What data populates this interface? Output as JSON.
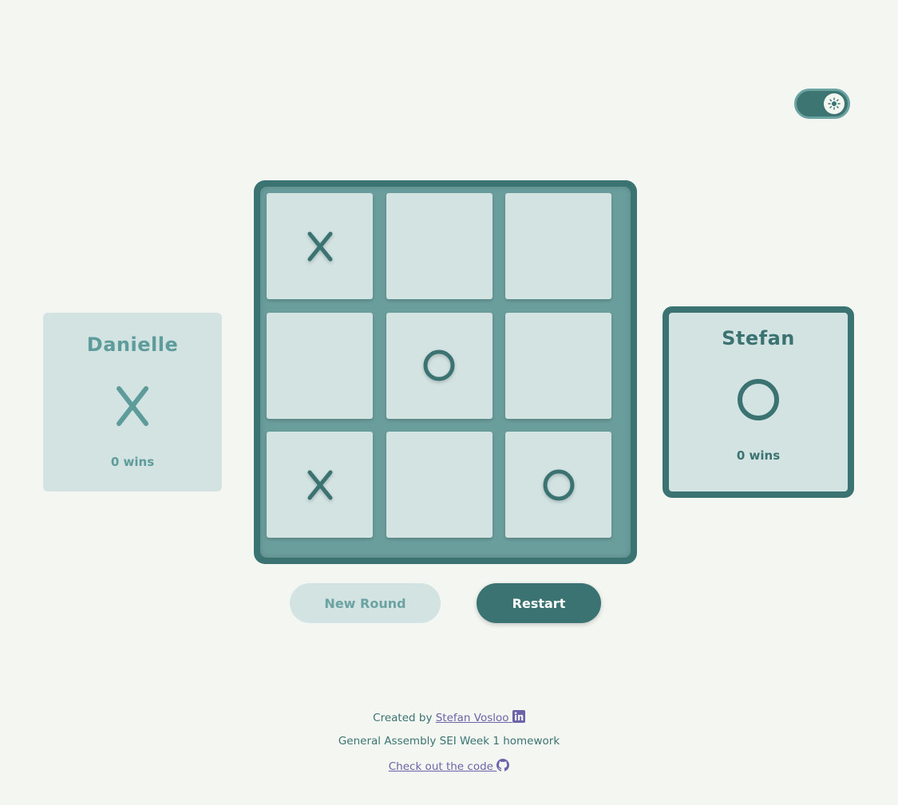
{
  "theme_toggle": {
    "icon": "sun-icon",
    "state": "dark-on"
  },
  "players": [
    {
      "name": "Danielle",
      "mark": "X",
      "wins": "0 wins",
      "active": false
    },
    {
      "name": "Stefan",
      "mark": "O",
      "wins": "0 wins",
      "active": true
    }
  ],
  "board": {
    "cells": [
      "X",
      "",
      "",
      "",
      "O",
      "",
      "X",
      "",
      "O"
    ]
  },
  "buttons": {
    "new_round": "New Round",
    "restart": "Restart"
  },
  "footer": {
    "created_by": "Created by",
    "author": "Stefan Vosloo",
    "author_icon": "linkedin-icon",
    "course": "General Assembly SEI Week 1 homework",
    "code_link": "Check out the code",
    "code_icon": "github-icon"
  },
  "colors": {
    "background": "#f4f6f2",
    "primary": "#3a7371",
    "light": "#d2e3e2",
    "muted": "#6ba3a3",
    "link": "#6c63a8"
  }
}
